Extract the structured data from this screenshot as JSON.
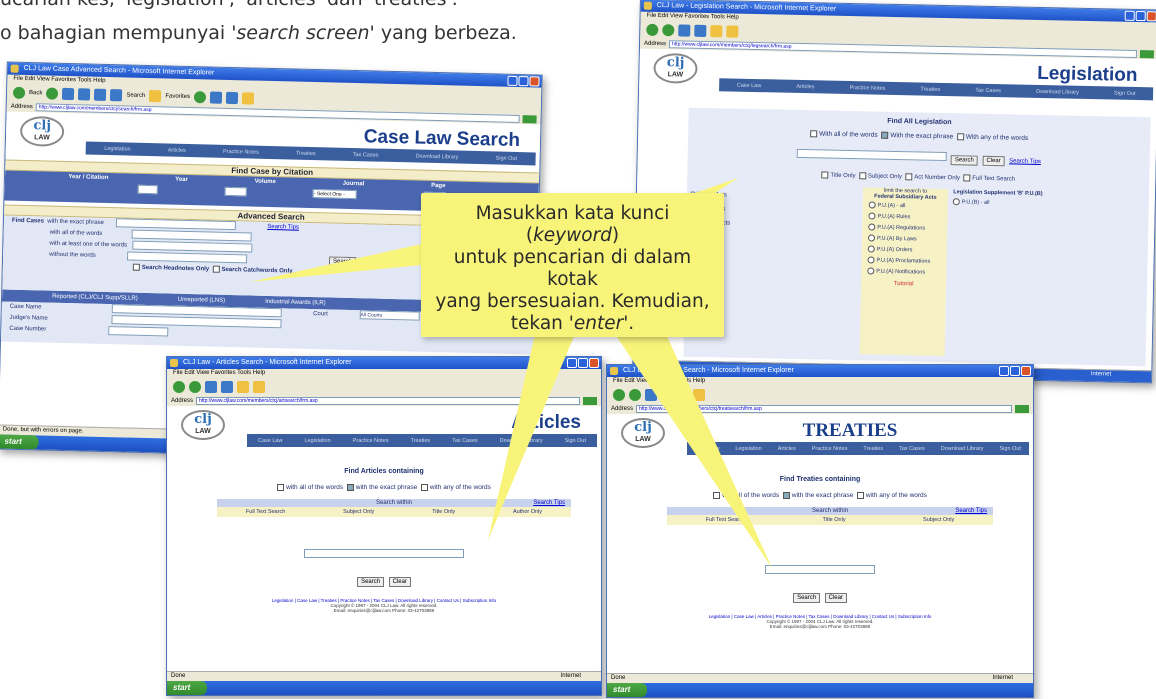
{
  "intro": {
    "line1": "ucarian kes, 'legislation', 'articles' dan 'treaties'.",
    "line2_pre": "o bahagian mempunyai ",
    "line2_em": "'search screen'",
    "line2_post": " yang berbeza."
  },
  "callout": {
    "line1_pre": "Masukkan kata kunci (",
    "line1_em": "keyword",
    "line1_post": ")",
    "line2": "untuk pencarian di dalam kotak",
    "line3": "yang bersesuaian. Kemudian,",
    "line4_pre": "tekan ",
    "line4_em": "'enter'",
    "line4_post": "."
  },
  "windows": {
    "case_law": {
      "title": "CLJ Law Case Advanced Search - Microsoft Internet Explorer",
      "menu": "File  Edit  View  Favorites  Tools  Help",
      "toolbar_back": "Back",
      "toolbar_search": "Search",
      "toolbar_favorites": "Favorites",
      "address": "http://www.cljlaw.com/members/ctcj/search/frm.asp",
      "banner": "Case Law Search",
      "nav": [
        "Legislation",
        "Articles",
        "Practice Notes",
        "Treaties",
        "Tax Cases",
        "Download Library",
        "Sign Out"
      ],
      "find_citation": "Find Case by Citation",
      "col_headers": [
        "Year / Citation",
        "Year",
        "Volume",
        "Journal",
        "Page"
      ],
      "journal_select": "- Select One -",
      "advanced": "Advanced Search",
      "find_cases": "Find Cases",
      "exact_phrase": "with the exact phrase",
      "all_words": "with all of the words",
      "at_least_one": "with at least one of the words",
      "without": "without the words",
      "search_tips": "Search Tips",
      "search_btn": "Search",
      "headnotes_only": "Search Headnotes Only",
      "catchwords": "Search Catchwords Only",
      "reported": "Reported (CLJ/CLJ Supp/SLLR)",
      "unreported": "Unreported (LNS)",
      "industrial": "Industrial Awards (ILR)",
      "case_name": "Case Name",
      "judge_name": "Judge's Name",
      "case_number": "Case Number",
      "court_label": "Court",
      "court_value": "All Courts",
      "status": "Done, but with errors on page.",
      "start": "start"
    },
    "legislation": {
      "title": "CLJ Law - Legislation Search - Microsoft Internet Explorer",
      "menu": "File  Edit  View  Favorites  Tools  Help",
      "address": "http://www.cljlaw.com/members/ctcj/legsearch/frm.asp",
      "banner": "Legislation",
      "nav": [
        "Case Law",
        "Articles",
        "Practice Notes",
        "Treaties",
        "Tax Cases",
        "Download Library",
        "Sign Out"
      ],
      "find_all": "Find All Legislation",
      "opt_all": "With all of the words",
      "opt_exact": "With the exact phrase",
      "opt_any": "With any of the words",
      "search_btn": "Search",
      "clear_btn": "Clear",
      "search_tips": "Search Tips",
      "title_only": "Title Only",
      "subject_only": "Subject Only",
      "act_number": "Act Number Only",
      "full_text": "Full Text Search",
      "limit": "limit the search to",
      "col_federal": "Federal Subsidiary Acts",
      "col_supp": "Legislation Supplement 'B' P.U.(B)",
      "federal_items": [
        "P.U.(A) - all",
        "P.U.(A) Rules",
        "P.U.(A) Regulations",
        "P.U.(A) By Laws",
        "P.U.(A) Orders",
        "P.U.(A) Proclamations",
        "P.U.(A) Notifications"
      ],
      "supp_item": "P.U.(B) - all",
      "principal": "Principal Acts",
      "revised": "Revised Acts",
      "amending": "Amending Acts",
      "tutorial": "Tutorial",
      "status": "Internet"
    },
    "articles": {
      "title": "CLJ Law - Articles Search - Microsoft Internet Explorer",
      "menu": "File  Edit  View  Favorites  Tools  Help",
      "address": "http://www.cljlaw.com/members/ctcj/artsearch/frm.asp",
      "banner": "Articles",
      "nav": [
        "Case Law",
        "Legislation",
        "Practice Notes",
        "Treaties",
        "Tax Cases",
        "Download Library",
        "Sign Out"
      ],
      "find": "Find Articles containing",
      "opt_all": "with all of the words",
      "opt_exact": "with the exact phrase",
      "opt_any": "with any of the words",
      "search_within": "Search within",
      "search_tips": "Search Tips",
      "within": [
        "Full Text Search",
        "Subject Only",
        "Title Only",
        "Author Only"
      ],
      "search_btn": "Search",
      "clear_btn": "Clear",
      "footer_links": "Legislation | Case Law | Treaties | Practice Notes | Tax Cases | Download Library | Contact Us | Subscription Info",
      "copyright": "Copyright © 1997 - 2004 CLJ Law. All rights reserved.",
      "email": "Email: enquiries@cljlaw.com  Phone: 03-42703888",
      "status": "Done",
      "status_right": "Internet",
      "start": "start"
    },
    "treaties": {
      "title": "CLJ Law - Treaties Search - Microsoft Internet Explorer",
      "menu": "File  Edit  View  Favorites  Tools  Help",
      "address": "http://www.cljlaw.com/members/ctcj/treatsearch/frm.asp",
      "banner": "TREATIES",
      "nav": [
        "Case Law",
        "Legislation",
        "Articles",
        "Practice Notes",
        "Treaties",
        "Tax Cases",
        "Download Library",
        "Sign Out"
      ],
      "find": "Find Treaties containing",
      "opt_all": "with all of the words",
      "opt_exact": "with the exact phrase",
      "opt_any": "with any of the words",
      "search_within": "Search within",
      "search_tips": "Search Tips",
      "within": [
        "Full Text Search",
        "Title Only",
        "Subject Only"
      ],
      "search_btn": "Search",
      "clear_btn": "Clear",
      "footer_links": "Legislation | Case Law | Articles | Practice Notes | Tax Cases | Download Library | Contact Us | Subscription Info",
      "copyright": "Copyright © 1997 - 2004 CLJ Law. All rights reserved.",
      "email": "Email: enquiries@cljlaw.com  Phone: 03-42703888",
      "status": "Done",
      "status_right": "Internet",
      "start": "start"
    }
  }
}
